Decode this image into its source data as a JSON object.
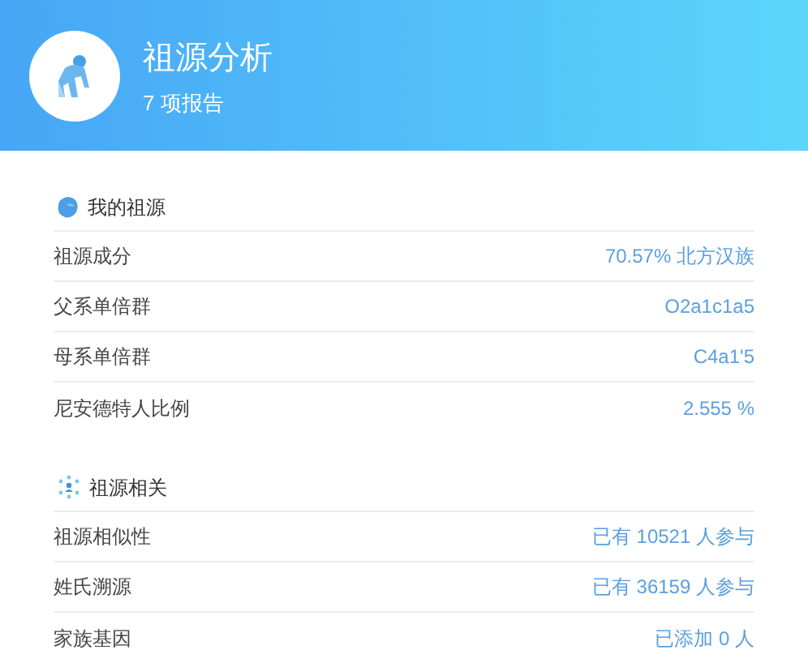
{
  "header": {
    "title": "祖源分析",
    "subtitle": "7 项报告"
  },
  "sections": [
    {
      "title": "我的祖源",
      "rows": [
        {
          "label": "祖源成分",
          "value": "70.57% 北方汉族"
        },
        {
          "label": "父系单倍群",
          "value": "O2a1c1a5"
        },
        {
          "label": "母系单倍群",
          "value": "C4a1'5"
        },
        {
          "label": "尼安德特人比例",
          "value": "2.555 %"
        }
      ]
    },
    {
      "title": "祖源相关",
      "rows": [
        {
          "label": "祖源相似性",
          "value": "已有 10521 人参与"
        },
        {
          "label": "姓氏溯源",
          "value": "已有 36159 人参与"
        },
        {
          "label": "家族基因",
          "value": "已添加 0 人"
        }
      ]
    }
  ]
}
